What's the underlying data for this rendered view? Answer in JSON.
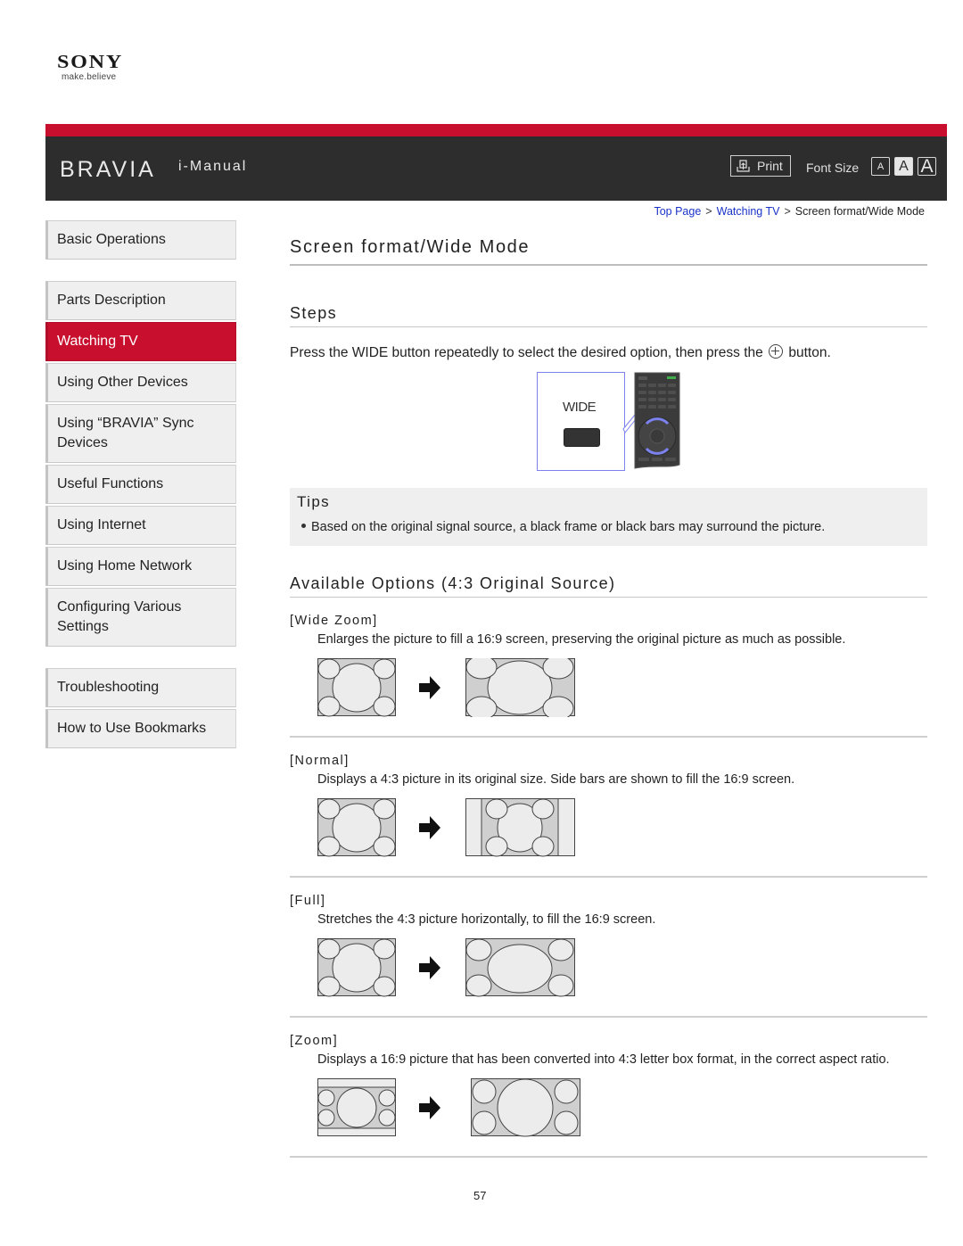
{
  "brand": {
    "logo": "SONY",
    "tagline": "make.believe",
    "product": "BRAVIA",
    "manual": "i-Manual"
  },
  "header": {
    "print_label": "Print",
    "print_icon": "print-icon",
    "font_size_label": "Font Size",
    "font_size_options": [
      "A",
      "A",
      "A"
    ],
    "font_size_selected": "medium",
    "accent_color": "#c8102e",
    "bar_color": "#2d2d2d"
  },
  "breadcrumb": {
    "items": [
      {
        "label": "Top Page",
        "link": true
      },
      {
        "label": "Watching TV",
        "link": true
      },
      {
        "label": "Screen format/Wide Mode",
        "link": false
      }
    ],
    "separator": ">"
  },
  "sidebar": {
    "groups": [
      [
        {
          "label": "Basic Operations",
          "active": false
        }
      ],
      [
        {
          "label": "Parts Description",
          "active": false
        },
        {
          "label": "Watching TV",
          "active": true
        },
        {
          "label": "Using Other Devices",
          "active": false
        },
        {
          "label": "Using “BRAVIA” Sync Devices",
          "active": false
        },
        {
          "label": "Useful Functions",
          "active": false
        },
        {
          "label": "Using Internet",
          "active": false
        },
        {
          "label": "Using Home Network",
          "active": false
        },
        {
          "label": "Configuring Various Settings",
          "active": false
        }
      ],
      [
        {
          "label": "Troubleshooting",
          "active": false
        },
        {
          "label": "How to Use Bookmarks",
          "active": false
        }
      ]
    ]
  },
  "main": {
    "title": "Screen format/Wide Mode",
    "steps": {
      "heading": "Steps",
      "text_before": "Press the WIDE button repeatedly to select the desired option, then press the",
      "icon": "enter-button-icon",
      "text_after": "button."
    },
    "remote_figure": {
      "button_label": "WIDE"
    },
    "tips": {
      "heading": "Tips",
      "items": [
        "Based on the original signal source, a black frame or black bars may surround the picture."
      ]
    },
    "options": {
      "heading": "Available Options (4:3 Original Source)",
      "items": [
        {
          "name": "[Wide Zoom]",
          "description": "Enlarges the picture to fill a 16:9 screen, preserving the original picture as much as possible.",
          "from": "4:3",
          "to": "wide-zoom"
        },
        {
          "name": "[Normal]",
          "description": "Displays a 4:3 picture in its original size. Side bars are shown to fill the 16:9 screen.",
          "from": "4:3",
          "to": "normal"
        },
        {
          "name": "[Full]",
          "description": "Stretches the 4:3 picture horizontally, to fill the 16:9 screen.",
          "from": "4:3",
          "to": "full"
        },
        {
          "name": "[Zoom]",
          "description": "Displays a 16:9 picture that has been converted into 4:3 letter box format, in the correct aspect ratio.",
          "from": "letterbox",
          "to": "zoom"
        }
      ]
    }
  },
  "footer": {
    "page_number": "57"
  }
}
